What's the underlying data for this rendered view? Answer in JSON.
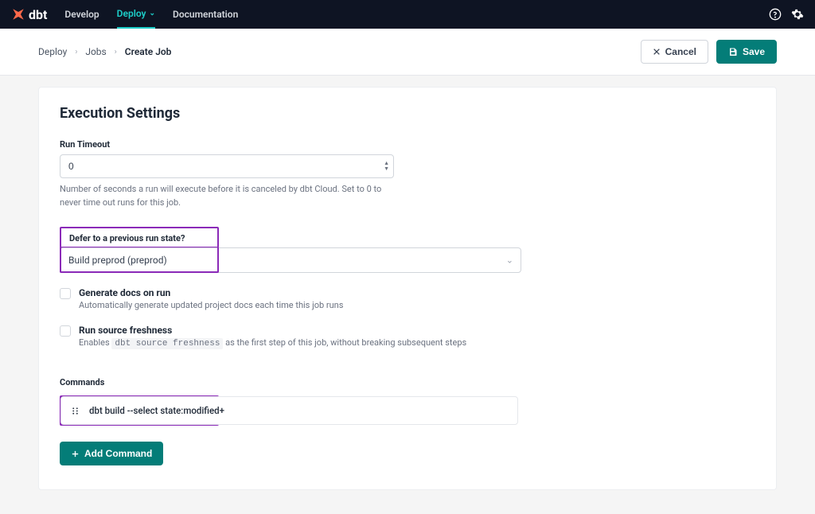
{
  "nav": {
    "logo_text": "dbt",
    "items": [
      {
        "label": "Develop",
        "active": false,
        "has_dropdown": false
      },
      {
        "label": "Deploy",
        "active": true,
        "has_dropdown": true
      },
      {
        "label": "Documentation",
        "active": false,
        "has_dropdown": false
      }
    ]
  },
  "breadcrumb": {
    "items": [
      "Deploy",
      "Jobs",
      "Create Job"
    ]
  },
  "actions": {
    "cancel": "Cancel",
    "save": "Save"
  },
  "section": {
    "title": "Execution Settings",
    "run_timeout": {
      "label": "Run Timeout",
      "value": "0",
      "help": "Number of seconds a run will execute before it is canceled by dbt Cloud. Set to 0 to never time out runs for this job."
    },
    "defer": {
      "label": "Defer to a previous run state?",
      "value": "Build preprod (preprod)"
    },
    "generate_docs": {
      "title": "Generate docs on run",
      "desc": "Automatically generate updated project docs each time this job runs",
      "checked": false
    },
    "source_freshness": {
      "title": "Run source freshness",
      "desc_prefix": "Enables ",
      "desc_code": "dbt source freshness",
      "desc_suffix": " as the first step of this job, without breaking subsequent steps",
      "checked": false
    },
    "commands": {
      "label": "Commands",
      "items": [
        "dbt build --select state:modified+"
      ],
      "add_label": "Add Command"
    }
  },
  "colors": {
    "primary": "#047d78",
    "highlight": "#8b2ab8",
    "nav_bg": "#0e1423",
    "nav_active": "#1dcec9"
  }
}
